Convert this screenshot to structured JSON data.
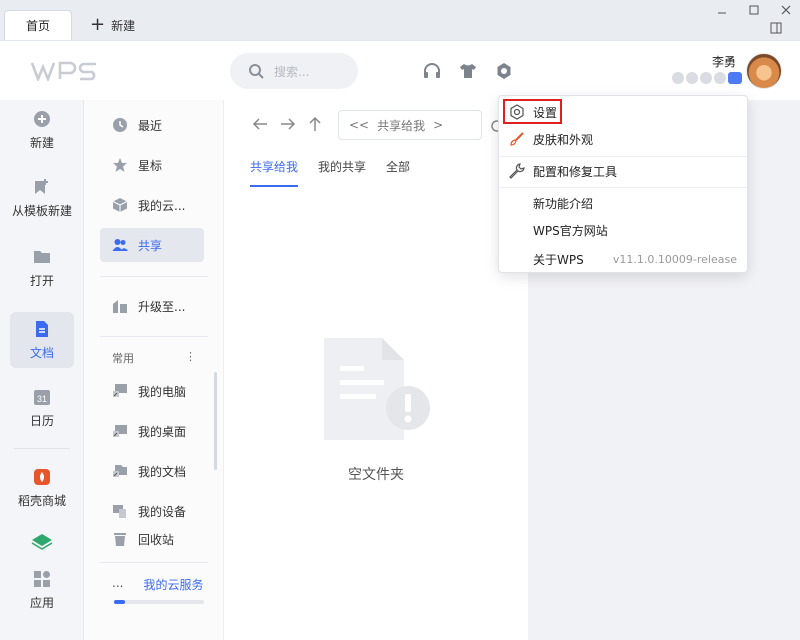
{
  "tabs": {
    "home": "首页",
    "new_tab": "新建"
  },
  "header": {
    "search_placeholder": "搜索...",
    "username": "李勇",
    "logo_text": "WPS"
  },
  "rail": [
    {
      "label": "新建",
      "icon": "plus-circle-icon"
    },
    {
      "label": "从模板新建",
      "icon": "template-icon"
    },
    {
      "label": "打开",
      "icon": "folder-icon"
    },
    {
      "label": "文档",
      "icon": "document-icon",
      "active": true
    },
    {
      "label": "日历",
      "icon": "calendar-icon",
      "icon_text": "31"
    },
    {
      "label": "稻壳商城",
      "icon": "docer-store-icon"
    },
    {
      "label": "应用",
      "icon": "apps-grid-icon"
    }
  ],
  "sidebar": {
    "items": [
      {
        "label": "最近",
        "icon": "clock-icon"
      },
      {
        "label": "星标",
        "icon": "star-icon"
      },
      {
        "label": "我的云...",
        "icon": "cloud-box-icon"
      },
      {
        "label": "共享",
        "icon": "people-icon",
        "active": true
      },
      {
        "label": "升级至...",
        "icon": "upgrade-icon"
      }
    ],
    "common_header": "常用",
    "common_more": "⋮",
    "common": [
      {
        "label": "我的电脑",
        "icon": "computer-icon"
      },
      {
        "label": "我的桌面",
        "icon": "desktop-icon"
      },
      {
        "label": "我的文档",
        "icon": "my-docs-icon"
      },
      {
        "label": "我的设备",
        "icon": "device-icon"
      },
      {
        "label": "回收站",
        "icon": "trash-icon"
      }
    ],
    "cloud_dots": "...",
    "cloud_service": "我的云服务",
    "cloud_usage": 0.12
  },
  "main": {
    "path_back": "<<",
    "path_current": "共享给我",
    "path_chevron": ">",
    "tabs": [
      "共享给我",
      "我的共享",
      "全部"
    ],
    "active_tab": 0,
    "empty_text": "空文件夹"
  },
  "menu": {
    "items": [
      {
        "label": "设置",
        "icon": "gear-icon"
      },
      {
        "label": "皮肤和外观",
        "icon": "brush-icon"
      },
      {
        "label": "配置和修复工具",
        "icon": "wrench-icon"
      },
      {
        "label": "新功能介绍"
      },
      {
        "label": "WPS官方网站"
      },
      {
        "label": "关于WPS",
        "version": "v11.1.0.10009-release"
      }
    ]
  },
  "colors": {
    "accent": "#3b6bf0",
    "highlight": "#e02020",
    "docer": "#e8552b",
    "apps_green": "#2fa66b"
  }
}
